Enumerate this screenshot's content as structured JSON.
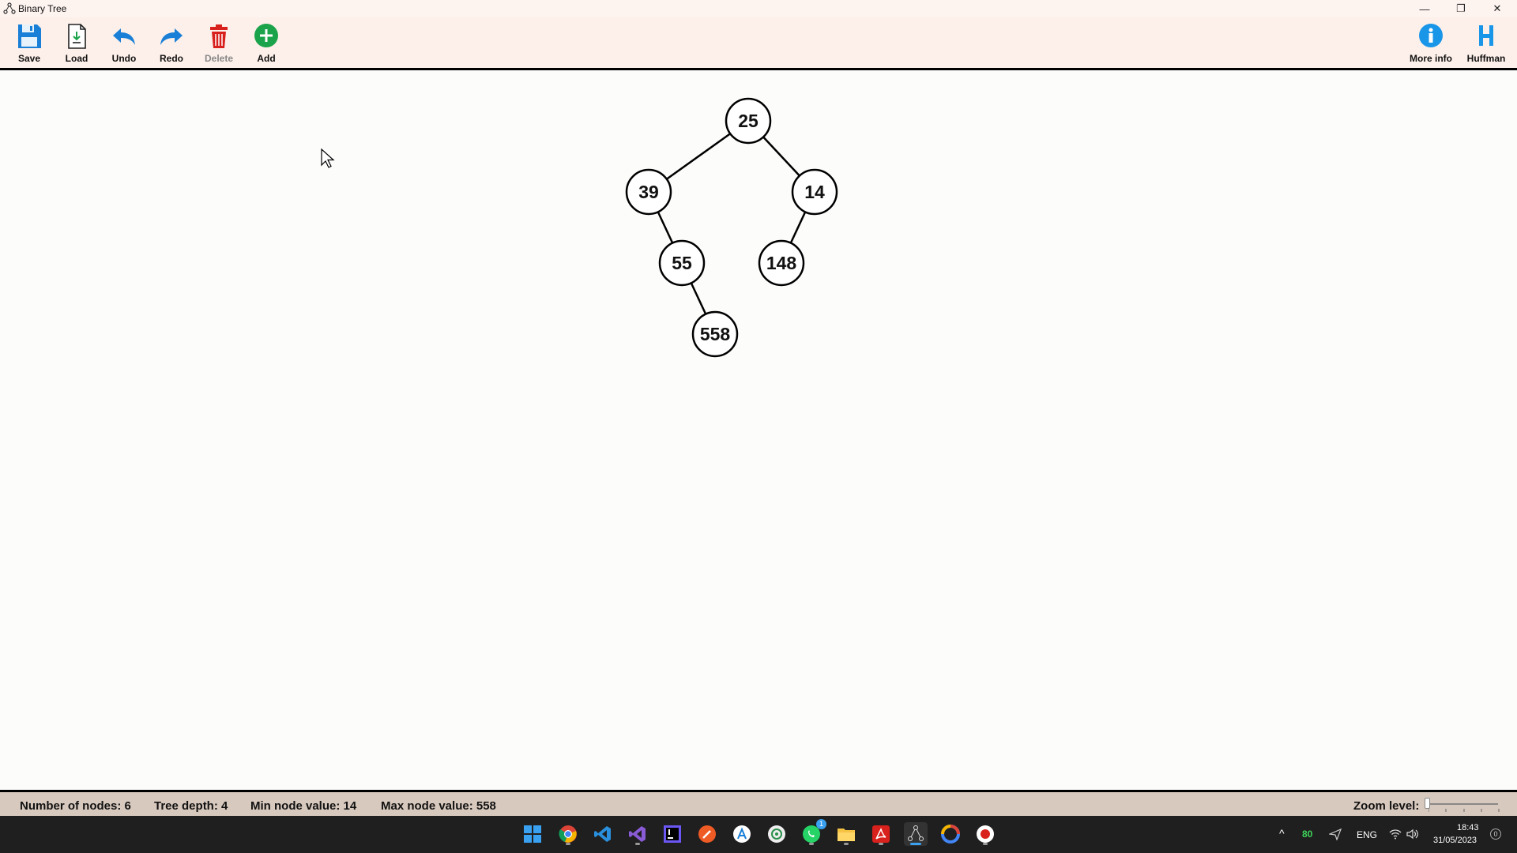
{
  "window": {
    "title": "Binary Tree",
    "minimize": "—",
    "restore": "❐",
    "close": "✕"
  },
  "toolbar": {
    "save": "Save",
    "load": "Load",
    "undo": "Undo",
    "redo": "Redo",
    "delete": "Delete",
    "add": "Add",
    "more_info": "More info",
    "huffman": "Huffman"
  },
  "tree": {
    "nodes": [
      {
        "id": "n25",
        "value": "25"
      },
      {
        "id": "n39",
        "value": "39"
      },
      {
        "id": "n14",
        "value": "14"
      },
      {
        "id": "n55",
        "value": "55"
      },
      {
        "id": "n148",
        "value": "148"
      },
      {
        "id": "n558",
        "value": "558"
      }
    ],
    "edges": [
      [
        "n25",
        "n39"
      ],
      [
        "n25",
        "n14"
      ],
      [
        "n39",
        "n55"
      ],
      [
        "n14",
        "n148"
      ],
      [
        "n55",
        "n558"
      ]
    ]
  },
  "status": {
    "nodes": "Number of nodes: 6",
    "depth": "Tree depth: 4",
    "min": "Min node value: 14",
    "max": "Max node value: 558",
    "zoom_label": "Zoom level:",
    "zoom_level": 0
  },
  "taskbar": {
    "apps": [
      "start",
      "chrome",
      "vscode",
      "visual-studio",
      "intellij",
      "postman",
      "app-a",
      "app-b",
      "whatsapp",
      "file-explorer",
      "acrobat",
      "binary-tree",
      "google",
      "recorder"
    ],
    "whatsapp_badge": "1",
    "tray": {
      "battery": "80",
      "lang": "ENG",
      "time": "18:43",
      "date": "31/05/2023",
      "notif": "0"
    }
  },
  "colors": {
    "toolbar_bg": "#fdf0ea",
    "status_bg": "#d8c9be",
    "accent_blue": "#1a7fd6",
    "delete_red": "#d8201c",
    "add_green": "#1aa34a"
  }
}
